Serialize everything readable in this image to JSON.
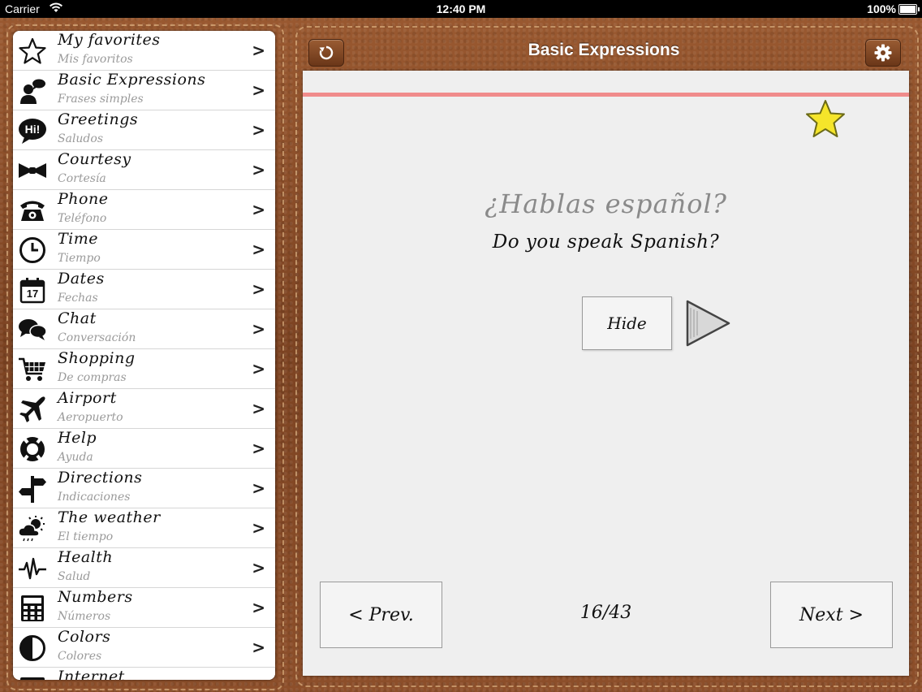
{
  "status_bar": {
    "carrier": "Carrier",
    "time": "12:40 PM",
    "battery": "100%"
  },
  "sidebar": {
    "items": [
      {
        "title": "My favorites",
        "subtitle": "Mis favoritos",
        "icon": "star-icon"
      },
      {
        "title": "Basic Expressions",
        "subtitle": "Frases simples",
        "icon": "speaker-person-icon"
      },
      {
        "title": "Greetings",
        "subtitle": "Saludos",
        "icon": "hi-bubble-icon",
        "icon_text": "Hi!"
      },
      {
        "title": "Courtesy",
        "subtitle": "Cortesía",
        "icon": "bowtie-icon"
      },
      {
        "title": "Phone",
        "subtitle": "Teléfono",
        "icon": "phone-icon"
      },
      {
        "title": "Time",
        "subtitle": "Tiempo",
        "icon": "clock-icon"
      },
      {
        "title": "Dates",
        "subtitle": "Fechas",
        "icon": "calendar-icon",
        "icon_text": "17"
      },
      {
        "title": "Chat",
        "subtitle": "Conversación",
        "icon": "chat-bubbles-icon"
      },
      {
        "title": "Shopping",
        "subtitle": "De compras",
        "icon": "cart-icon"
      },
      {
        "title": "Airport",
        "subtitle": "Aeropuerto",
        "icon": "airplane-icon"
      },
      {
        "title": "Help",
        "subtitle": "Ayuda",
        "icon": "lifebuoy-icon"
      },
      {
        "title": "Directions",
        "subtitle": "Indicaciones",
        "icon": "signpost-icon"
      },
      {
        "title": "The weather",
        "subtitle": "El tiempo",
        "icon": "weather-icon"
      },
      {
        "title": "Health",
        "subtitle": "Salud",
        "icon": "heartbeat-icon"
      },
      {
        "title": "Numbers",
        "subtitle": "Números",
        "icon": "calculator-icon"
      },
      {
        "title": "Colors",
        "subtitle": "Colores",
        "icon": "contrast-icon"
      },
      {
        "title": "Internet",
        "subtitle": "",
        "icon": "computer-icon"
      }
    ],
    "chevron": ">"
  },
  "header": {
    "title": "Basic Expressions"
  },
  "card": {
    "phrase_es": "¿Hablas español?",
    "phrase_en": "Do you speak Spanish?",
    "hide_label": "Hide",
    "prev_label": "< Prev.",
    "next_label": "Next >",
    "counter": "16/43",
    "favorite": true
  },
  "colors": {
    "accent_line": "#f08b8b",
    "star": "#f5e52a",
    "leather": "#8a4f2a"
  }
}
